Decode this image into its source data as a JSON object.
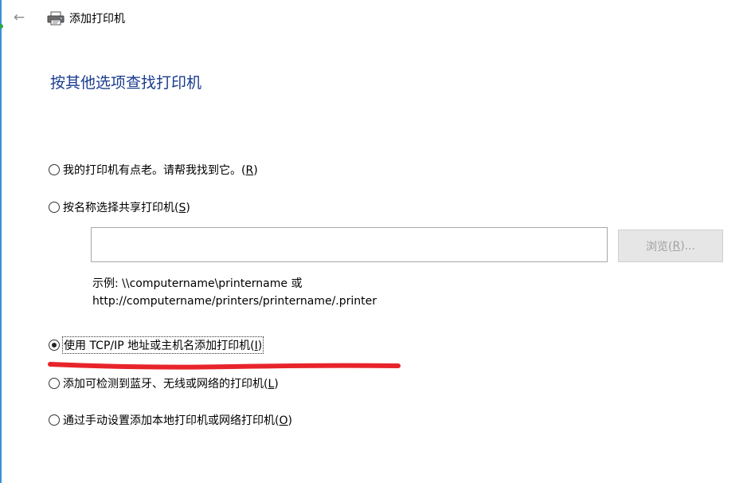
{
  "window": {
    "title": "添加打印机"
  },
  "page": {
    "heading": "按其他选项查找打印机"
  },
  "options": [
    {
      "text": "我的打印机有点老。请帮我找到它。",
      "key_paren_open": "(",
      "key": "R",
      "key_paren_close": ")",
      "checked": false
    },
    {
      "text": "按名称选择共享打印机",
      "key_paren_open": "(",
      "key": "S",
      "key_paren_close": ")",
      "checked": false
    },
    {
      "text": "使用 TCP/IP 地址或主机名添加打印机",
      "key_paren_open": "(",
      "key": "I",
      "key_paren_close": ")",
      "checked": true
    },
    {
      "text": "添加可检测到蓝牙、无线或网络的打印机",
      "key_paren_open": "(",
      "key": "L",
      "key_paren_close": ")",
      "checked": false
    },
    {
      "text": "通过手动设置添加本地打印机或网络打印机",
      "key_paren_open": "(",
      "key": "O",
      "key_paren_close": ")",
      "checked": false
    }
  ],
  "share": {
    "input_value": "",
    "browse_prefix": "浏览(",
    "browse_key": "R",
    "browse_suffix": ")...",
    "example_line1": "示例: \\\\computername\\printername 或",
    "example_line2": "http://computername/printers/printername/.printer"
  },
  "colors": {
    "heading": "#1a3c8f",
    "annotation": "#e8242b",
    "disabled_button_text": "#a0a0a0"
  }
}
